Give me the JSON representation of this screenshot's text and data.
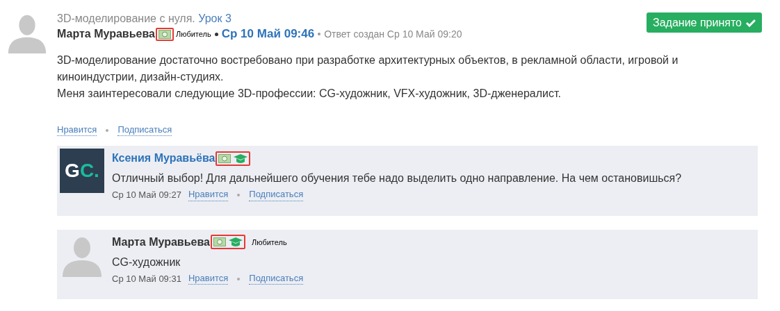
{
  "post": {
    "course": "3D-моделирование с нуля.",
    "lesson": "Урок 3",
    "author": "Марта Муравьева",
    "badges": [
      {
        "kind": "money"
      }
    ],
    "badges_highlighted": true,
    "role": "Любитель",
    "date": "Ср 10 Май 09:46",
    "created": "Ответ создан Ср 10 Май 09:20",
    "status_button": "Задание принято",
    "body": [
      "3D-моделирование достаточно востребовано при разработке архитектурных объектов, в рекламной области, игровой и киноиндустрии, дизайн-студиях.",
      "Меня заинтересовали следующие 3D-профессии: CG-художник, VFX-художник, 3D-дженералист."
    ],
    "actions": [
      "Нравится",
      "Подписаться"
    ]
  },
  "comments": [
    {
      "avatar": {
        "kind": "logo",
        "letters": [
          "G",
          "C."
        ]
      },
      "author": "Ксения Муравьёва",
      "author_is_link": true,
      "badges": [
        {
          "kind": "money"
        },
        {
          "kind": "cap"
        }
      ],
      "badges_highlighted": true,
      "text": "Отличный выбор! Для дальнейшего обучения тебе надо выделить одно направление. На чем остановишься?",
      "date": "Ср 10 Май 09:27",
      "actions": [
        "Нравится",
        "Подписаться"
      ]
    },
    {
      "avatar": {
        "kind": "silhouette"
      },
      "author": "Марта Муравьева",
      "author_is_link": false,
      "badges": [
        {
          "kind": "money"
        },
        {
          "kind": "cap"
        }
      ],
      "badges_highlighted": true,
      "role": "Любитель",
      "text": "CG-художник",
      "date": "Ср 10 Май 09:31",
      "actions": [
        "Нравится",
        "Подписаться"
      ]
    }
  ]
}
